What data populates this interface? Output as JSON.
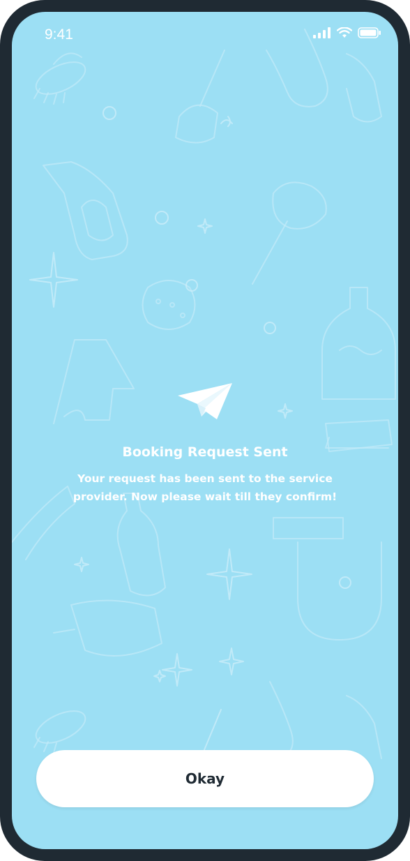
{
  "status_bar": {
    "time": "9:41",
    "icons": [
      "signal-icon",
      "wifi-icon",
      "battery-icon"
    ]
  },
  "confirmation": {
    "icon": "paper-plane-icon",
    "title": "Booking Request Sent",
    "message": "Your request has been sent to the service provider. Now please wait till they confirm!"
  },
  "actions": {
    "okay_label": "Okay"
  },
  "colors": {
    "frame": "#1f2a33",
    "background": "#9cdff4",
    "text": "#ffffff",
    "button_bg": "#ffffff",
    "button_text": "#1f2a33"
  }
}
